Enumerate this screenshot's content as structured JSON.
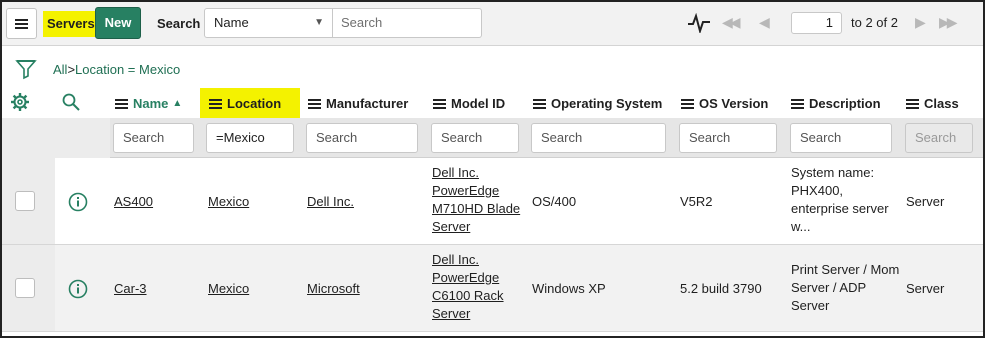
{
  "header": {
    "list_title": "Servers",
    "new_button": "New",
    "search_label": "Search",
    "search_field": "Name",
    "search_placeholder": "Search",
    "page_current": "1",
    "page_total": "to 2 of 2"
  },
  "breadcrumb": {
    "all": "All",
    "separator": ">",
    "filter": "Location = Mexico"
  },
  "columns": [
    {
      "label": "Name",
      "search": "Search"
    },
    {
      "label": "Location",
      "search": "=Mexico"
    },
    {
      "label": "Manufacturer",
      "search": "Search"
    },
    {
      "label": "Model ID",
      "search": "Search"
    },
    {
      "label": "Operating System",
      "search": "Search"
    },
    {
      "label": "OS Version",
      "search": "Search"
    },
    {
      "label": "Description",
      "search": "Search"
    },
    {
      "label": "Class",
      "search": "Search"
    }
  ],
  "rows": [
    {
      "name": "AS400",
      "location": "Mexico",
      "manufacturer": "Dell Inc.",
      "model_id": [
        "Dell Inc.",
        "PowerEdge",
        "M710HD Blade",
        "Server"
      ],
      "os": "OS/400",
      "os_version": "V5R2",
      "description": [
        "System name:",
        "PHX400,",
        "enterprise server",
        "w..."
      ],
      "class": "Server"
    },
    {
      "name": "Car-3",
      "location": "Mexico",
      "manufacturer": "Microsoft",
      "model_id": [
        "Dell Inc.",
        "PowerEdge",
        "C6100 Rack",
        "Server"
      ],
      "os": "Windows XP",
      "os_version": "5.2 build 3790",
      "description": [
        "Print Server / Mom",
        "Server / ADP",
        "Server"
      ],
      "class": "Server"
    }
  ],
  "colors": {
    "highlight": "#f4f200",
    "primary": "#278062",
    "link": "#1f6f53"
  },
  "icons": [
    "menu-icon",
    "activity-pulse-icon",
    "first-page-icon",
    "prev-page-icon",
    "next-page-icon",
    "last-page-icon",
    "filter-icon",
    "gear-icon",
    "search-icon",
    "info-icon",
    "sort-ascending-icon"
  ]
}
